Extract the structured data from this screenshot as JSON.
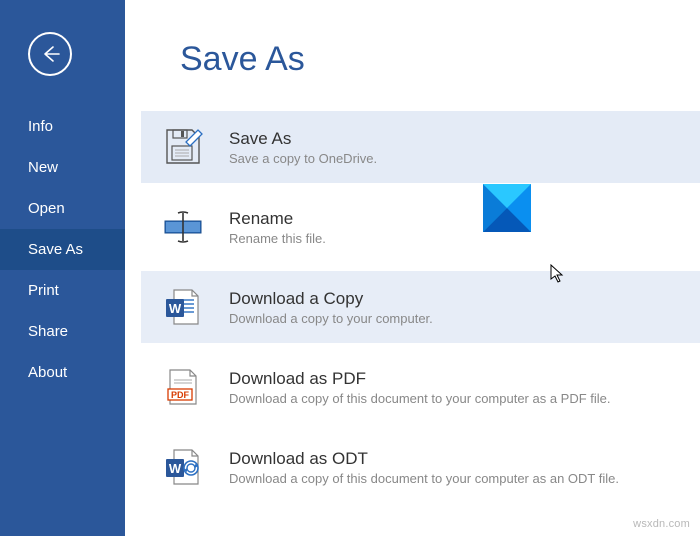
{
  "sidebar": {
    "items": [
      {
        "label": "Info",
        "selected": false
      },
      {
        "label": "New",
        "selected": false
      },
      {
        "label": "Open",
        "selected": false
      },
      {
        "label": "Save As",
        "selected": true
      },
      {
        "label": "Print",
        "selected": false
      },
      {
        "label": "Share",
        "selected": false
      },
      {
        "label": "About",
        "selected": false
      }
    ]
  },
  "page": {
    "title": "Save As"
  },
  "options": [
    {
      "title": "Save As",
      "desc": "Save a copy to OneDrive.",
      "state": "highlight"
    },
    {
      "title": "Rename",
      "desc": "Rename this file.",
      "state": "normal"
    },
    {
      "title": "Download a Copy",
      "desc": "Download a copy to your computer.",
      "state": "hover"
    },
    {
      "title": "Download as PDF",
      "desc": "Download a copy of this document to your computer as a PDF file.",
      "state": "normal"
    },
    {
      "title": "Download as ODT",
      "desc": "Download a copy of this document to your computer as an ODT file.",
      "state": "normal"
    }
  ],
  "watermark": "wsxdn.com"
}
